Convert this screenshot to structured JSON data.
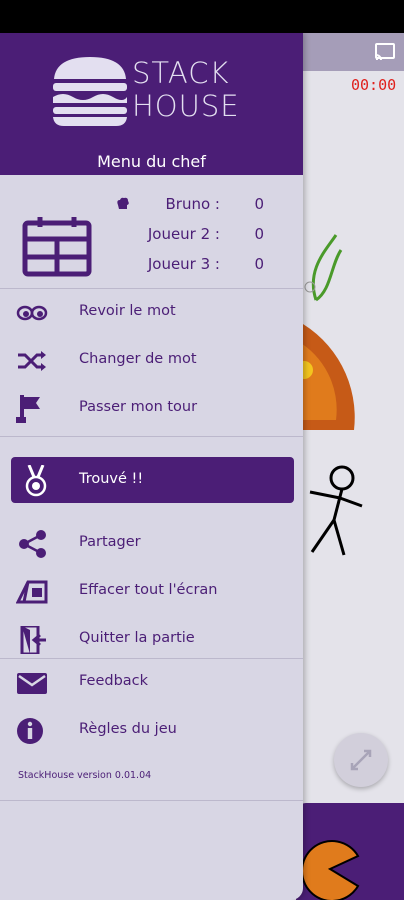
{
  "timer": "00:00",
  "header": {
    "logo_line1": "STACK",
    "logo_line2": "HOUSE",
    "menu_title": "Menu du chef"
  },
  "players": [
    {
      "name": "Bruno :",
      "score": "0"
    },
    {
      "name": "Joueur 2 :",
      "score": "0"
    },
    {
      "name": "Joueur 3 :",
      "score": "0"
    }
  ],
  "menu": {
    "review_word": "Revoir le mot",
    "change_word": "Changer de mot",
    "skip_turn": "Passer mon tour",
    "found": "Trouvé !!",
    "share": "Partager",
    "clear_screen": "Effacer tout l'écran",
    "quit_game": "Quitter la partie",
    "feedback": "Feedback",
    "rules": "Règles du jeu"
  },
  "version": "StackHouse version 0.01.04",
  "colors": {
    "brand_purple": "#4b1e76",
    "drawer_bg": "#d8d6e4",
    "timer_red": "#e0201c"
  },
  "icons": {
    "review_word": "eyes-icon",
    "change_word": "shuffle-icon",
    "skip_turn": "flag-icon",
    "found": "medal-icon",
    "share": "share-icon",
    "clear_screen": "eraser-icon",
    "quit_game": "exit-door-icon",
    "feedback": "envelope-icon",
    "rules": "info-icon"
  }
}
